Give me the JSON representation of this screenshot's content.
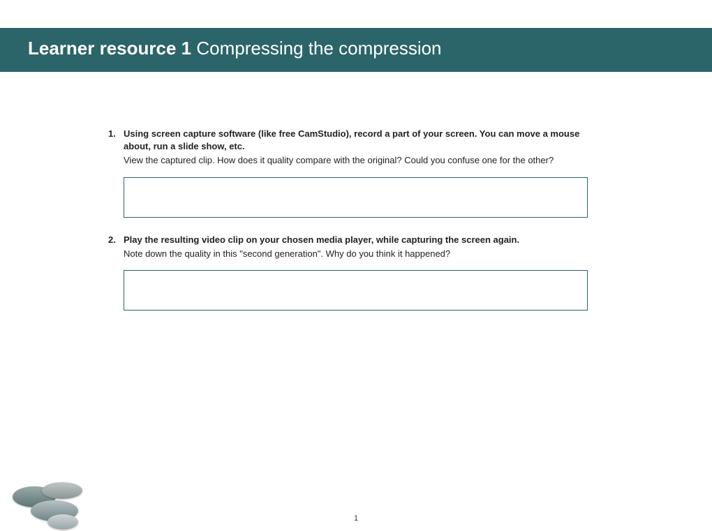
{
  "header": {
    "title_bold": "Learner resource 1",
    "title_light": " Compressing the compression"
  },
  "questions": [
    {
      "number": "1.",
      "prompt": "Using screen capture software (like free CamStudio), record a part of your screen. You can move a mouse about, run a slide show, etc.",
      "sub": "View the captured clip. How does it quality compare with the original? Could you confuse one for the other?"
    },
    {
      "number": "2.",
      "prompt": "Play the resulting video clip on your chosen media player, while capturing the screen again.",
      "sub": "Note down the quality in this \"second generation\". Why do you think it happened?"
    }
  ],
  "page_number": "1"
}
